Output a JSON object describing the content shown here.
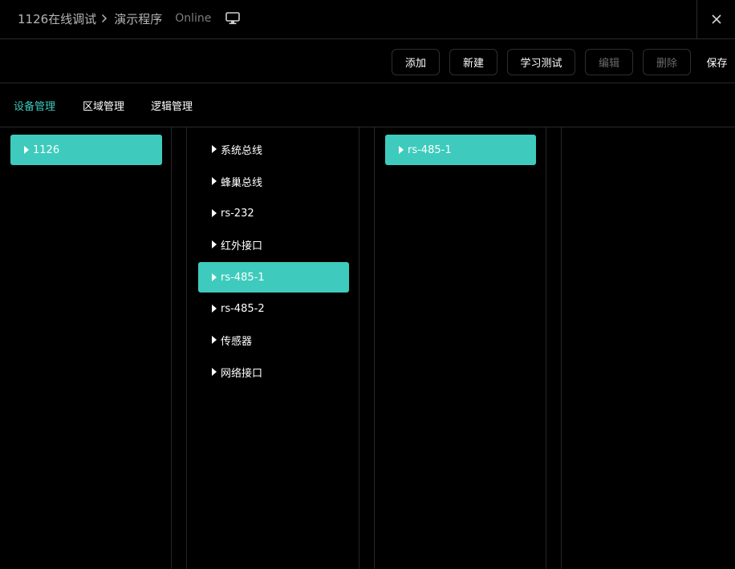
{
  "header": {
    "project": "1126在线调试",
    "program": "演示程序",
    "status": "Online"
  },
  "toolbar": {
    "add": "添加",
    "new": "新建",
    "learn_test": "学习测试",
    "edit": "编辑",
    "delete": "删除",
    "save": "保存"
  },
  "tabs": {
    "device": "设备管理",
    "area": "区域管理",
    "logic": "逻辑管理"
  },
  "columns": {
    "col1": [
      "1126"
    ],
    "col2": [
      "系统总线",
      "蜂巢总线",
      "rs-232",
      "红外接口",
      "rs-485-1",
      "rs-485-2",
      "传感器",
      "网络接口"
    ],
    "col3": [
      "rs-485-1"
    ]
  },
  "colors": {
    "accent": "#3ecbbd",
    "background": "#000000",
    "border": "#2a2a2a"
  },
  "icons": {
    "breadcrumb_separator": "chevron-right-icon",
    "status": "monitor-icon",
    "close": "close-icon",
    "tree_item": "caret-right-icon"
  }
}
